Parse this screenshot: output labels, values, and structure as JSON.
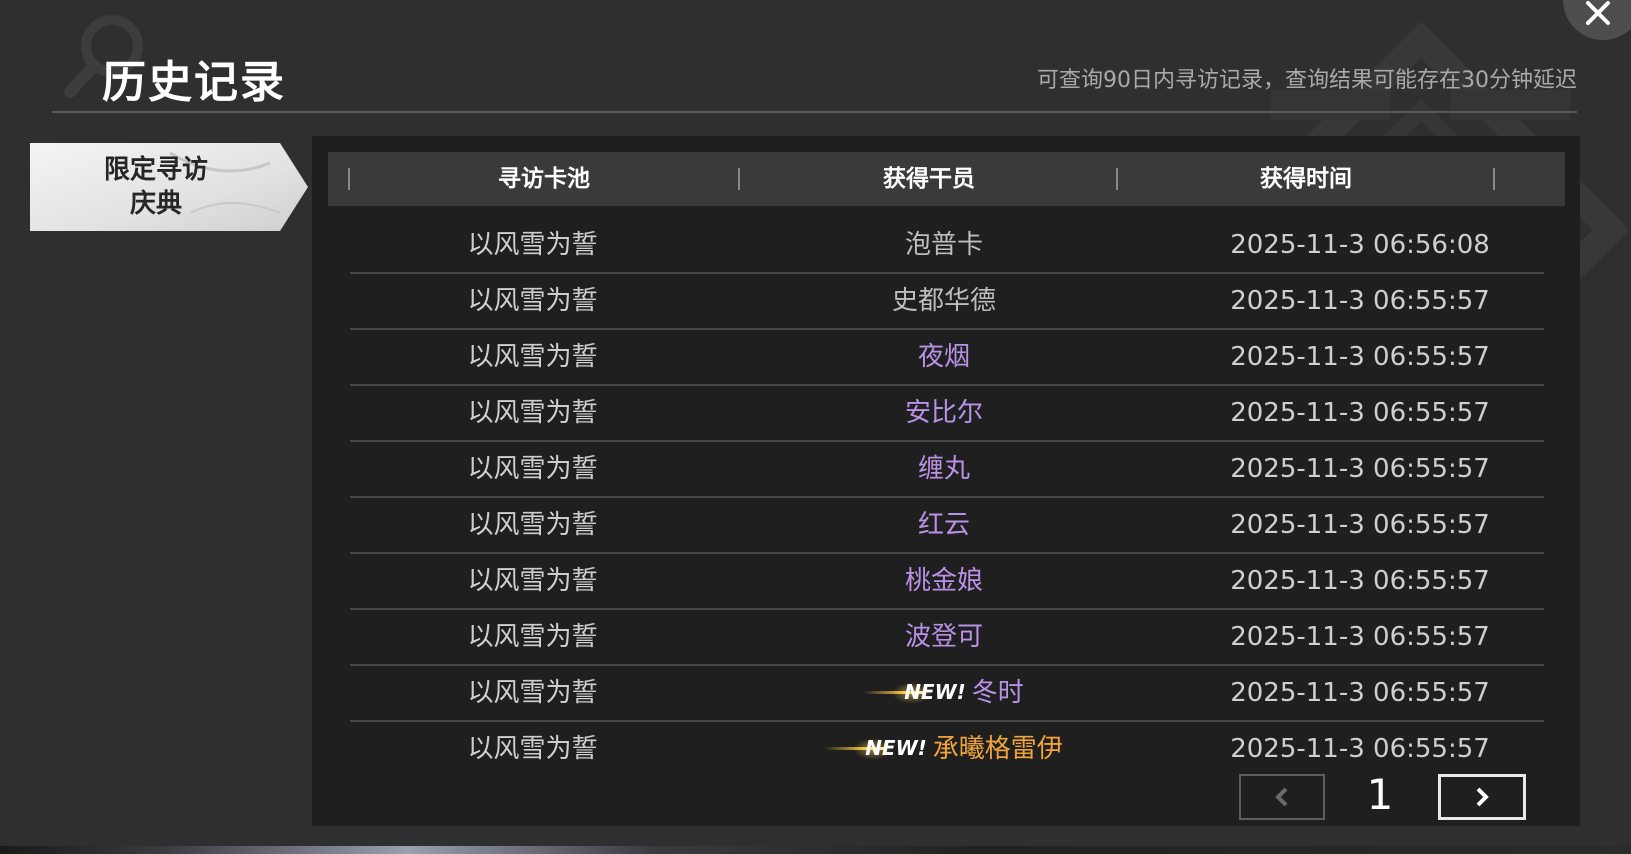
{
  "header": {
    "title": "历史记录",
    "notice": "可查询90日内寻访记录，查询结果可能存在30分钟延迟"
  },
  "side_tab": {
    "line1": "限定寻访",
    "line2": "庆典"
  },
  "table": {
    "columns": [
      "寻访卡池",
      "获得干员",
      "获得时间"
    ],
    "rows": [
      {
        "pool": "以风雪为誓",
        "operator": "泡普卡",
        "time": "2025-11-3 06:56:08",
        "rarity": "white",
        "new": false
      },
      {
        "pool": "以风雪为誓",
        "operator": "史都华德",
        "time": "2025-11-3 06:55:57",
        "rarity": "white",
        "new": false
      },
      {
        "pool": "以风雪为誓",
        "operator": "夜烟",
        "time": "2025-11-3 06:55:57",
        "rarity": "purple",
        "new": false
      },
      {
        "pool": "以风雪为誓",
        "operator": "安比尔",
        "time": "2025-11-3 06:55:57",
        "rarity": "purple",
        "new": false
      },
      {
        "pool": "以风雪为誓",
        "operator": "缠丸",
        "time": "2025-11-3 06:55:57",
        "rarity": "purple",
        "new": false
      },
      {
        "pool": "以风雪为誓",
        "operator": "红云",
        "time": "2025-11-3 06:55:57",
        "rarity": "purple",
        "new": false
      },
      {
        "pool": "以风雪为誓",
        "operator": "桃金娘",
        "time": "2025-11-3 06:55:57",
        "rarity": "purple",
        "new": false
      },
      {
        "pool": "以风雪为誓",
        "operator": "波登可",
        "time": "2025-11-3 06:55:57",
        "rarity": "purple",
        "new": false
      },
      {
        "pool": "以风雪为誓",
        "operator": "冬时",
        "time": "2025-11-3 06:55:57",
        "rarity": "purple",
        "new": true
      },
      {
        "pool": "以风雪为誓",
        "operator": "承曦格雷伊",
        "time": "2025-11-3 06:55:57",
        "rarity": "gold",
        "new": true
      }
    ],
    "new_badge_label": "NEW!"
  },
  "pagination": {
    "current_page": "1",
    "prev_icon": "chevron-left-icon",
    "next_icon": "chevron-right-icon"
  },
  "icons": {
    "close": "close-icon",
    "search_watermark": "search-icon"
  },
  "colors": {
    "rarity_white": "#bdbdbd",
    "rarity_purple": "#b992e6",
    "rarity_gold": "#f0a33a"
  }
}
